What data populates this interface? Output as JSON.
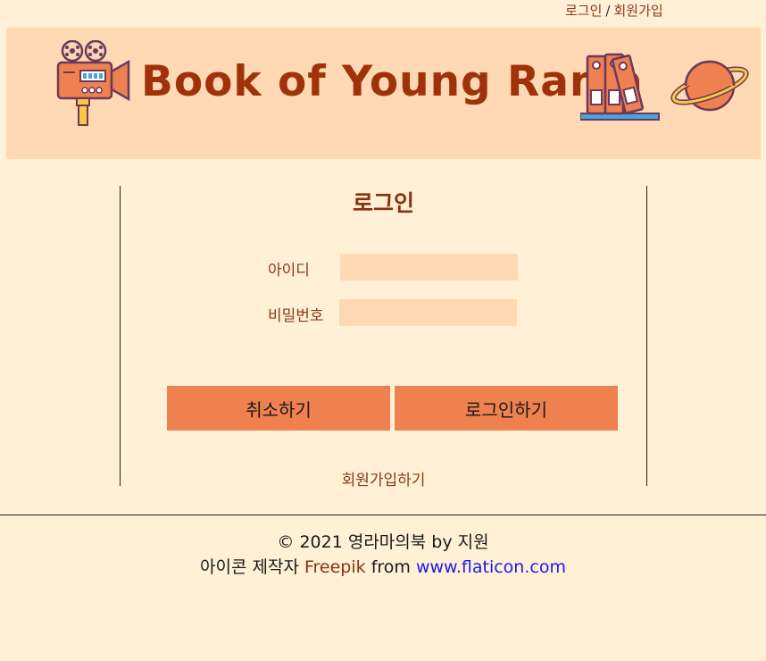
{
  "topnav": {
    "login": "로그인",
    "separator": "/",
    "signup": "회원가입"
  },
  "header": {
    "title": "Book of Young Rama"
  },
  "icons": [
    "movie-camera-icon",
    "books-icon",
    "planet-icon"
  ],
  "login": {
    "title": "로그인",
    "id_label": "아이디",
    "id_value": "",
    "password_label": "비밀번호",
    "password_value": "",
    "cancel_button": "취소하기",
    "submit_button": "로그인하기",
    "signup_link": "회원가입하기"
  },
  "footer": {
    "copyright": "© 2021 영라마의북 by 지원",
    "credit_prefix": "아이콘 제작자",
    "credit_author": "Freepik",
    "credit_from": "from",
    "credit_site": "www.flaticon.com"
  },
  "colors": {
    "page_bg": "#fff0d6",
    "banner_bg": "#ffd8b4",
    "title": "#a0320a",
    "button": "#ef8050",
    "link": "#1a1aee"
  }
}
